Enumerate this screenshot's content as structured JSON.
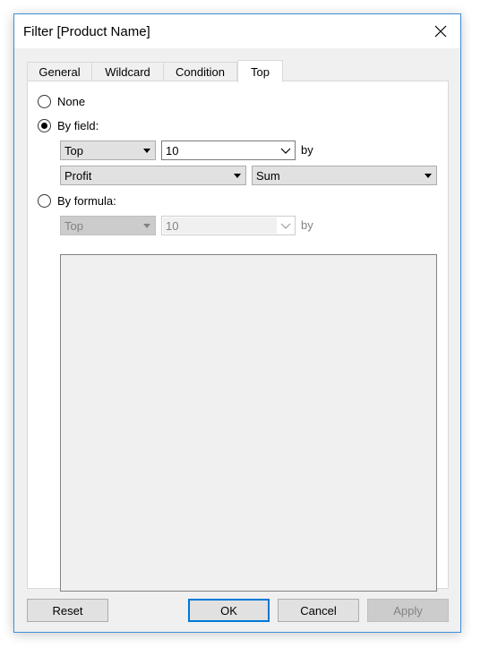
{
  "window": {
    "title": "Filter [Product Name]",
    "close_icon": "close-icon"
  },
  "tabs": [
    {
      "label": "General",
      "active": false
    },
    {
      "label": "Wildcard",
      "active": false
    },
    {
      "label": "Condition",
      "active": false
    },
    {
      "label": "Top",
      "active": true
    }
  ],
  "top_tab": {
    "none_label": "None",
    "by_field": {
      "label": "By field:",
      "selected": true,
      "direction_value": "Top",
      "count_value": "10",
      "by_label": "by",
      "field_value": "Profit",
      "aggregation_value": "Sum"
    },
    "by_formula": {
      "label": "By formula:",
      "selected": false,
      "direction_value": "Top",
      "count_value": "10",
      "by_label": "by"
    }
  },
  "buttons": {
    "reset": "Reset",
    "ok": "OK",
    "cancel": "Cancel",
    "apply": "Apply"
  },
  "colors": {
    "accent": "#0078d7",
    "window_border": "#3d8fd6",
    "disabled_text": "#838383"
  }
}
